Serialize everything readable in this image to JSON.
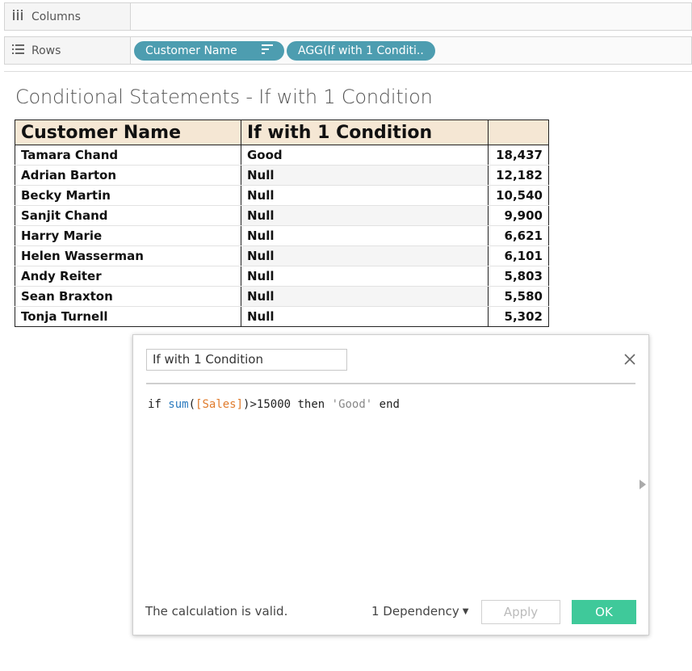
{
  "shelves": {
    "columns": {
      "icon": "columns-icon",
      "label": "Columns"
    },
    "rows": {
      "icon": "rows-icon",
      "label": "Rows",
      "pills": [
        {
          "label": "Customer Name",
          "icon": "sort-descending-icon"
        },
        {
          "label": "AGG(If with 1 Conditi.."
        }
      ]
    }
  },
  "sheet": {
    "title": "Conditional Statements - If with 1 Condition",
    "headers": [
      "Customer Name",
      "If with 1 Condition",
      ""
    ],
    "rows": [
      {
        "name": "Tamara Chand",
        "cond": "Good",
        "value": "18,437"
      },
      {
        "name": "Adrian Barton",
        "cond": "Null",
        "value": "12,182"
      },
      {
        "name": "Becky Martin",
        "cond": "Null",
        "value": "10,540"
      },
      {
        "name": "Sanjit Chand",
        "cond": "Null",
        "value": "9,900"
      },
      {
        "name": "Harry Marie",
        "cond": "Null",
        "value": "6,621"
      },
      {
        "name": "Helen Wasserman",
        "cond": "Null",
        "value": "6,101"
      },
      {
        "name": "Andy Reiter",
        "cond": "Null",
        "value": "5,803"
      },
      {
        "name": "Sean Braxton",
        "cond": "Null",
        "value": "5,580"
      },
      {
        "name": "Tonja Turnell",
        "cond": "Null",
        "value": "5,302"
      }
    ]
  },
  "dialog": {
    "calc_name": "If with 1 Condition",
    "close_icon": "close-icon",
    "code": {
      "kw_if": "if ",
      "fn_sum": "sum",
      "open": "(",
      "field": "[Sales]",
      "close": ")>15000 ",
      "kw_then": "then ",
      "string": "'Good'",
      "kw_end": " end"
    },
    "status": "The calculation is valid.",
    "dependency": "1 Dependency",
    "apply_label": "Apply",
    "ok_label": "OK"
  },
  "colors": {
    "pill": "#4d9db0",
    "header_bg": "#f5e7d4",
    "ok_button": "#3fc99a",
    "function": "#2b7bbf",
    "field": "#e07b2c"
  }
}
